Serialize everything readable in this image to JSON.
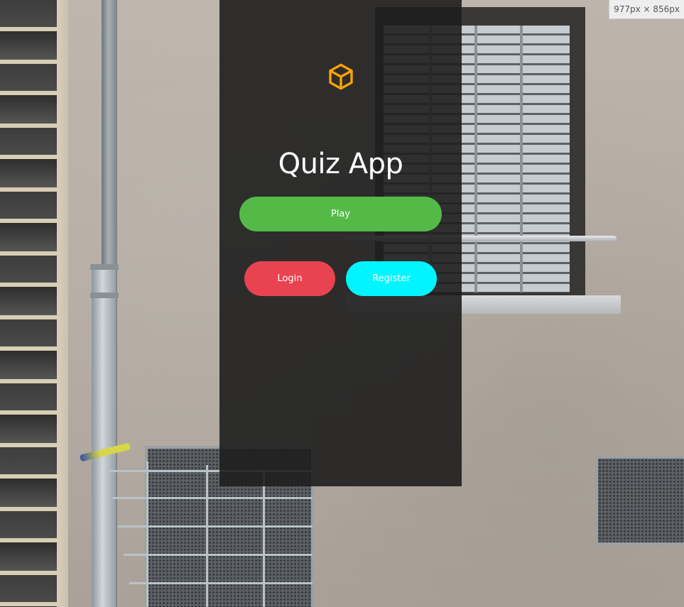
{
  "app": {
    "title": "Quiz App",
    "logo_icon": "cube-icon",
    "logo_color": "#ffa500"
  },
  "buttons": {
    "play_label": "Play",
    "login_label": "Login",
    "register_label": "Register"
  },
  "colors": {
    "play": "#55b947",
    "login": "#e94351",
    "register": "#00f5ff",
    "overlay": "rgba(30,30,30,0.9)"
  },
  "viewport_badge": {
    "text": "977px × 856px"
  }
}
